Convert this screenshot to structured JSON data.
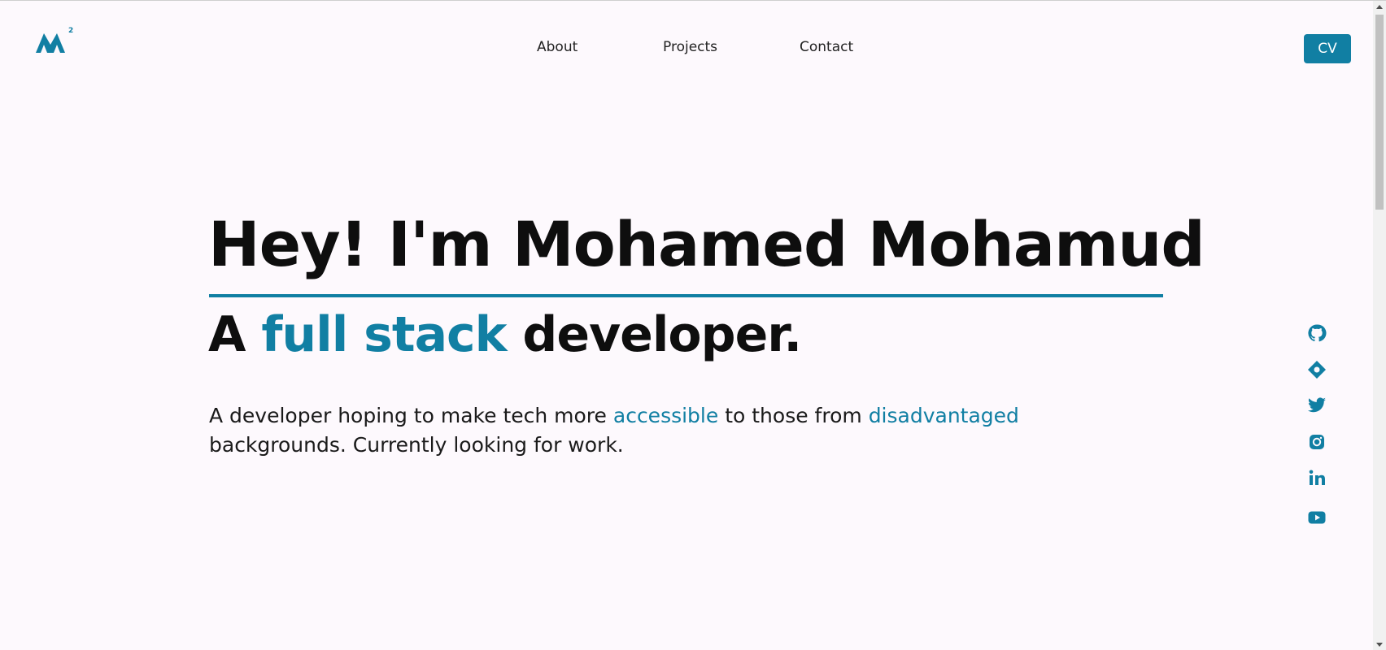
{
  "colors": {
    "accent": "#117fa3",
    "background": "#fdf9fd",
    "text": "#0e0e0e"
  },
  "logo": {
    "icon": "m-squared-logo-icon"
  },
  "nav": {
    "about": "About",
    "projects": "Projects",
    "contact": "Contact"
  },
  "cv_button": "CV",
  "hero": {
    "title": "Hey! I'm Mohamed Mohamud",
    "sub_prefix": "A ",
    "sub_accent": "full stack",
    "sub_suffix": " developer."
  },
  "description": {
    "part1": "A developer hoping to make tech more ",
    "accent1": "accessible",
    "part2": " to those from ",
    "accent2": "disadvantaged",
    "part3": " backgrounds. Currently looking for work."
  },
  "socials": [
    "github-icon",
    "location-icon",
    "twitter-icon",
    "instagram-icon",
    "linkedin-icon",
    "youtube-icon"
  ]
}
